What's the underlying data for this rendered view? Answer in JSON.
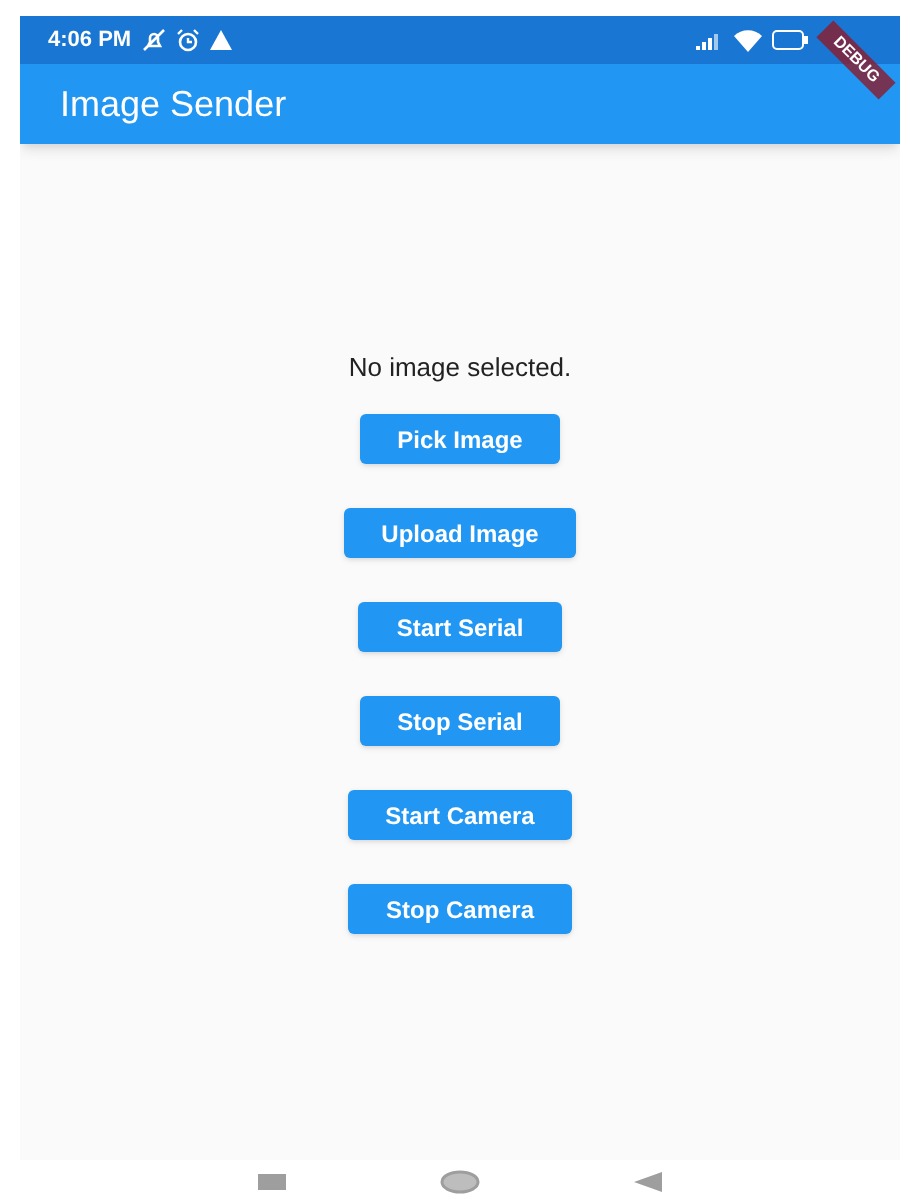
{
  "status_bar": {
    "time": "4:06 PM"
  },
  "debug_banner": {
    "label": "DEBUG"
  },
  "app_bar": {
    "title": "Image Sender"
  },
  "body": {
    "message": "No image selected.",
    "buttons": [
      "Pick Image",
      "Upload Image",
      "Start Serial",
      "Stop Serial",
      "Start Camera",
      "Stop Camera"
    ]
  }
}
